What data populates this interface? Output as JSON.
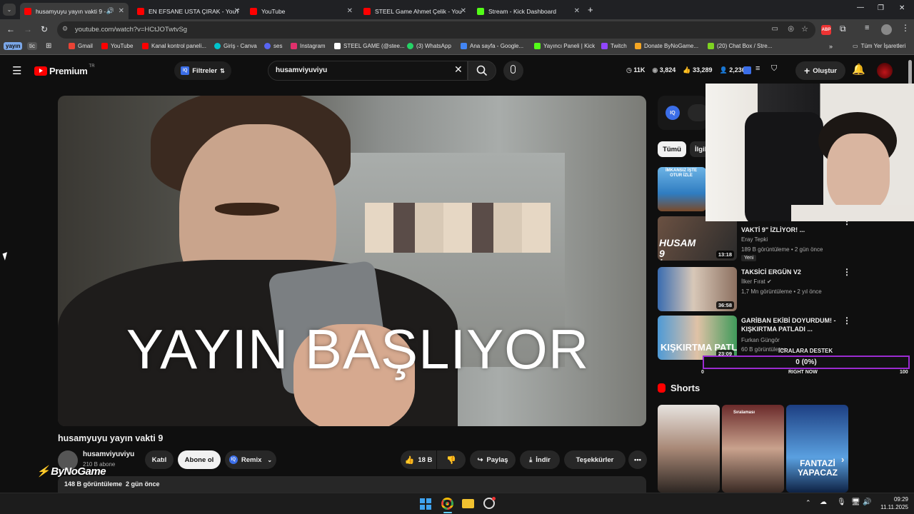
{
  "tabs": [
    {
      "title": "husamyuyu yayın vakti 9 - Y",
      "active": true,
      "color": "#ff0000"
    },
    {
      "title": "EN EFSANE USTA ÇIRAK - YouT",
      "color": "#ff0000"
    },
    {
      "title": "YouTube",
      "color": "#ff0000"
    },
    {
      "title": "STEEL Game Ahmet Çelik - You",
      "color": "#ff0000"
    },
    {
      "title": "Stream - Kick Dashboard",
      "color": "#53fc18"
    }
  ],
  "address": {
    "url": "youtube.com/watch?v=HCtJOTwtvSg"
  },
  "bookmarks": [
    {
      "label": "yayın"
    },
    {
      "label": "tic"
    },
    {
      "label": "Gmail",
      "color": "#ea4335"
    },
    {
      "label": "YouTube",
      "color": "#ff0000"
    },
    {
      "label": "Kanal kontrol paneli...",
      "color": "#ff0000"
    },
    {
      "label": "Giriş - Canva",
      "color": "#00c4cc"
    },
    {
      "label": "ses",
      "color": "#5865f2"
    },
    {
      "label": "Instagram",
      "color": "#e1306c"
    },
    {
      "label": "STEEL GAME (@stee...",
      "color": "#ffffff"
    },
    {
      "label": "(3) WhatsApp",
      "color": "#25d366"
    },
    {
      "label": "Ana sayfa - Google...",
      "color": "#4285f4"
    },
    {
      "label": "Yayıncı Paneli | Kick",
      "color": "#53fc18"
    },
    {
      "label": "Twitch",
      "color": "#9146ff"
    },
    {
      "label": "Donate ByNoGame...",
      "color": "#f5a623"
    },
    {
      "label": "(20) Chat Box / Stre...",
      "color": "#7ed321"
    },
    {
      "label": "Tüm Yer İşaretleri"
    }
  ],
  "yt": {
    "logo_text": "Premium",
    "logo_sup": "TR",
    "filters_label": "Filtreler",
    "search_value": "husamviyuviyu",
    "stats": [
      "11K",
      "3,824",
      "33,289",
      "2,236"
    ],
    "create_label": "Oluştur"
  },
  "video": {
    "overlay_text": "YAYIN BAŞLIYOR",
    "title": "husamyuyu yayın vakti 9",
    "channel": "husamviyuviyu",
    "subs": "210 B abone",
    "join": "Katıl",
    "subscribe": "Abone ol",
    "remix": "Remix",
    "likes": "18 B",
    "share": "Paylaş",
    "download": "İndir",
    "thanks": "Teşekkürler",
    "views": "148 B görüntüleme",
    "ago": "2 gün önce",
    "watermark": "ByNoGame"
  },
  "chips": [
    "Tümü",
    "İlgil"
  ],
  "related": [
    {
      "title": "VAKTİ 9\" İZLİYOR! ...",
      "channel": "Eray Tepki",
      "meta": "189 B görüntüleme • 2 gün önce",
      "badge": "Yeni",
      "duration": "13:18",
      "thumb_text": "HUSAM 9 İZLIYOR"
    },
    {
      "title": "TAKSİCİ ERGÜN V2",
      "channel": "İlker Fırat",
      "meta": "1,7 Mn görüntüleme • 2 yıl önce",
      "duration": "36:58"
    },
    {
      "title": "GARİBAN EKİBİ DOYURDUM! - KIŞKIRTMA PATLADI ...",
      "channel": "Furkan Güngör",
      "meta": "60 B görüntüleme",
      "duration": "23:09",
      "thumb_text": "KIŞKIRTMA PATL"
    }
  ],
  "first_thumb_text": "İMKANSIZ İŞTE OTUR İZLE",
  "donation": {
    "title": "İCRALARA DESTEK",
    "value": "0 (0%)",
    "min": "0",
    "max": "100",
    "now": "RIGHT NOW",
    "progress": 0
  },
  "shorts": {
    "heading": "Shorts",
    "short2_text": "Sıralaması",
    "short3_text": "FANTAZİ YAPACAZ"
  },
  "clock": {
    "time": "09:29",
    "date": "11.11.2025"
  }
}
